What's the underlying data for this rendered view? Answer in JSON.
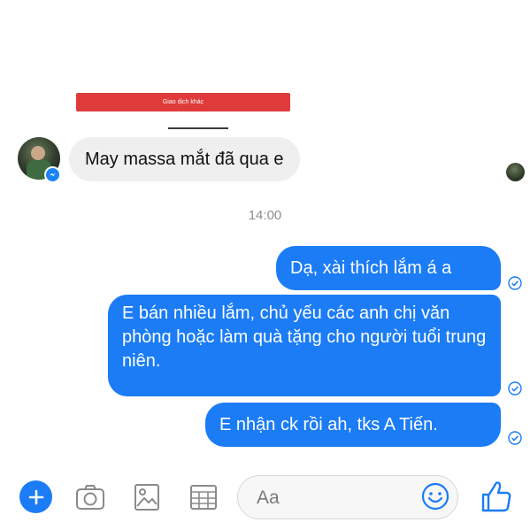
{
  "attachment": {
    "button_label": "Giao dịch khác"
  },
  "incoming": {
    "text": "May massa mắt đã qua e"
  },
  "timestamp": "14:00",
  "outgoing": [
    {
      "text": "Dạ, xài thích lắm á a"
    },
    {
      "text": "E bán nhiều lắm, chủ yếu các anh chị văn phòng hoặc làm quà tặng cho người tuổi trung niên."
    },
    {
      "text": "E nhận ck rồi ah, tks A Tiến."
    }
  ],
  "composer": {
    "placeholder": "Aa"
  },
  "colors": {
    "accent": "#1b7cf5",
    "incoming_bubble": "#efefef",
    "red_button": "#e03b3b"
  },
  "icons": [
    "plus-icon",
    "camera-icon",
    "gallery-icon",
    "gif-icon",
    "emoji-icon",
    "like-icon",
    "messenger-icon",
    "check-icon"
  ]
}
